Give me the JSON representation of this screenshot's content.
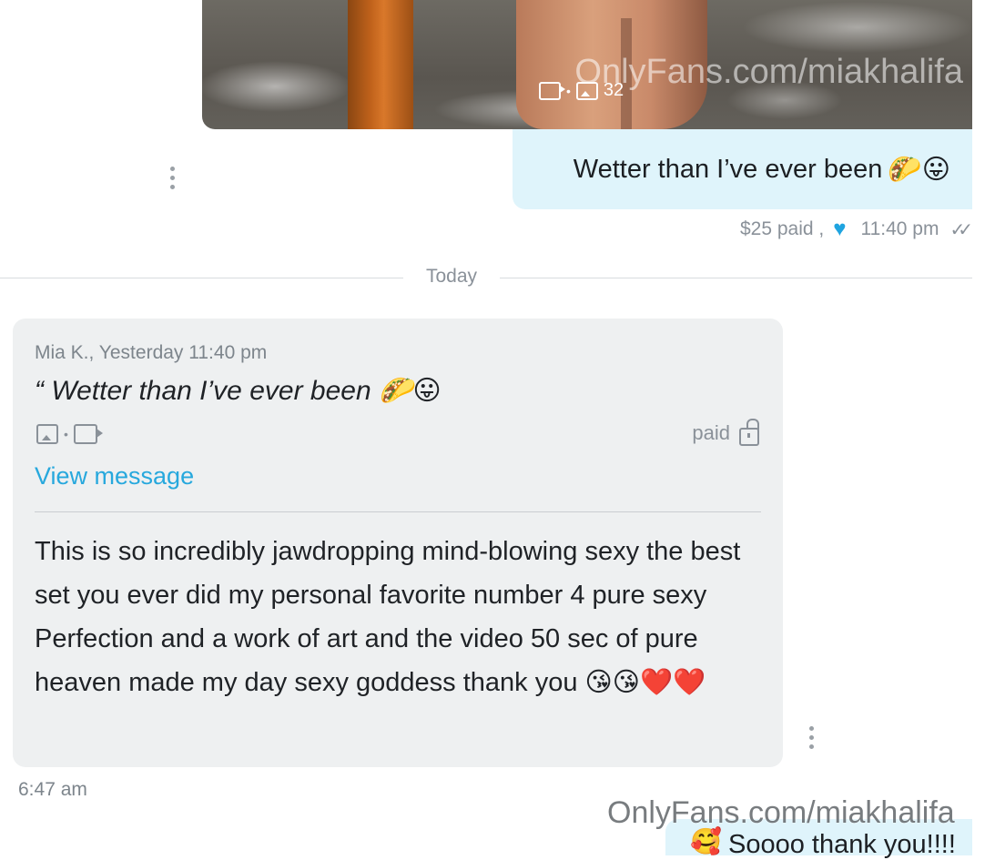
{
  "media_message": {
    "watermark": "OnlyFans.com/miakhalifa",
    "media_count": "32",
    "video_icon": "video-icon",
    "image_icon": "image-icon"
  },
  "sent_message": {
    "text": "Wetter than I’ve ever been",
    "emojis": "🌮😛",
    "price": "$25 paid ,",
    "time": "11:40 pm"
  },
  "divider": {
    "label": "Today"
  },
  "reply": {
    "quote_meta": "Mia K., Yesterday 11:40 pm",
    "quote_text": "“ Wetter than I’ve ever been 🌮😛",
    "paid_label": "paid",
    "view_link": "View message",
    "text": "This is so incredibly jawdropping mind-blowing sexy the best set you ever did my personal favorite number 4 pure sexy Perfection and a work of art and the video 50 sec of pure heaven made my day sexy goddess thank you 😘😘❤️❤️",
    "time": "6:47 am"
  },
  "next_message": {
    "emoji": "🥰",
    "peek_text": "Soooo thank you!!!!"
  },
  "page_watermark": "OnlyFans.com/miakhalifa",
  "colors": {
    "sent_bubble": "#dff4fb",
    "received_bubble": "#eef0f1",
    "link": "#27a8dd",
    "heart": "#1fa4e0"
  }
}
